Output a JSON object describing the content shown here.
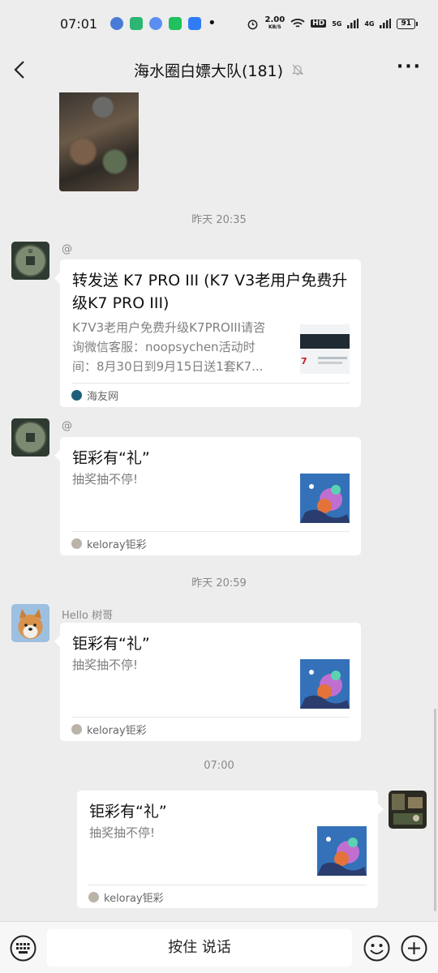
{
  "status": {
    "time": "07:01",
    "speed": "2.00",
    "speed_unit": "KB/S",
    "hd": "HD",
    "net5g": "5G",
    "net4g": "4G",
    "battery": "91"
  },
  "header": {
    "title": "海水圈白嫖大队(181)"
  },
  "messages": {
    "sep1": "昨天 20:35",
    "m1": {
      "sender": "@",
      "title": "转发送 K7 PRO III (K7 V3老用户免费升级K7 PRO III)",
      "desc": "K7V3老用户免费升级K7PROIII请咨询微信客服：noopsychen活动时间：8月30日到9月15日送1套K7...",
      "source": "海友网"
    },
    "m2": {
      "sender": "@",
      "title": "钜彩有“礼”",
      "desc": "抽奖抽不停!",
      "source": "keloray钜彩"
    },
    "sep2": "昨天 20:59",
    "m3": {
      "sender": "Hello   树哥",
      "title": "钜彩有“礼”",
      "desc": "抽奖抽不停!",
      "source": "keloray钜彩"
    },
    "sep3": "07:00",
    "m4": {
      "title": "钜彩有“礼”",
      "desc": "抽奖抽不停!",
      "source": "keloray钜彩"
    }
  },
  "input": {
    "voice_label": "按住 说话"
  },
  "icons": {
    "back": "back-arrow-icon",
    "mute": "bell-off-icon",
    "more": "more-icon",
    "keyboard": "keyboard-icon",
    "emoji": "emoji-icon",
    "plus": "plus-icon"
  }
}
